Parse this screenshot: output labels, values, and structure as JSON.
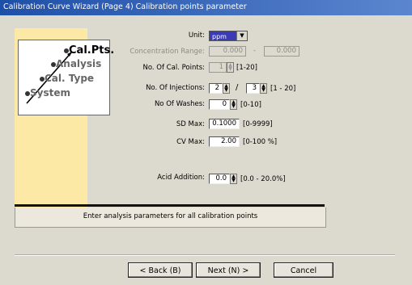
{
  "window": {
    "title": "Calibration Curve Wizard (Page 4) Calibration points parameter"
  },
  "steps": [
    "Cal.Pts.",
    "Analysis",
    "Cal. Type",
    "System"
  ],
  "form": {
    "unit_label": "Unit:",
    "unit_value": "ppm",
    "conc_range_label": "Concentration Range:",
    "conc_from": "0.000",
    "conc_dash": "-",
    "conc_to": "0.000",
    "num_cal_points_label": "No. Of Cal. Points:",
    "num_cal_points_value": "1",
    "num_cal_points_range": "[1-20]",
    "num_injections_label": "No. Of Injections:",
    "num_injections_value1": "2",
    "num_injections_slash": "/",
    "num_injections_value2": "3",
    "num_injections_range": "[1 - 20]",
    "num_washes_label": "No Of Washes:",
    "num_washes_value": "0",
    "num_washes_range": "[0-10]",
    "sd_max_label": "SD Max:",
    "sd_max_value": "0.1000",
    "sd_max_range": "[0-9999]",
    "cv_max_label": "CV Max:",
    "cv_max_value": "2.00",
    "cv_max_range": "[0-100 %]",
    "acid_addition_label": "Acid Addition:",
    "acid_addition_value": "0.0",
    "acid_addition_range": "[0.0 - 20.0%]"
  },
  "status_text": "Enter analysis parameters for all calibration points",
  "buttons": {
    "back": "< Back (B)",
    "next": "Next (N) >",
    "cancel": "Cancel"
  }
}
